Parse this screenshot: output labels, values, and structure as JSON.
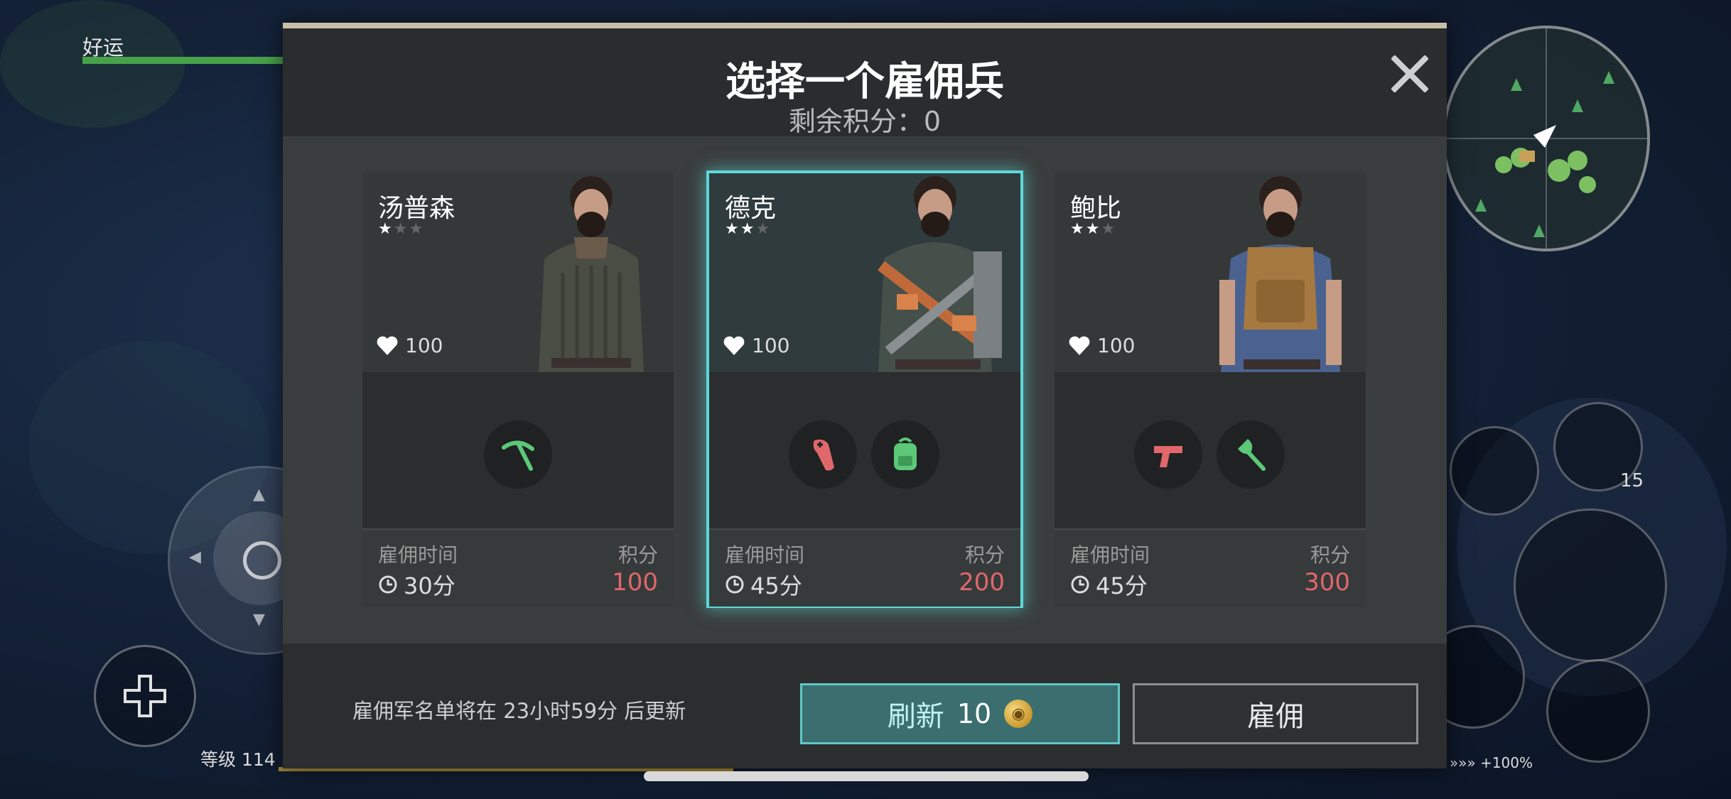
{
  "hud": {
    "player_name": "好运",
    "level_label": "等级 114",
    "item_count": "15",
    "boost_text": "»»» +100%"
  },
  "modal": {
    "title": "选择一个雇佣兵",
    "subtitle": "剩余积分：0",
    "footer_note": "雇佣军名单将在 23小时59分 后更新",
    "refresh_label": "刷新",
    "refresh_cost": "10",
    "hire_label": "雇佣"
  },
  "cards": [
    {
      "name": "汤普森",
      "stars": 1,
      "stars_max": 3,
      "hp": "100",
      "skills": [
        "pickaxe-icon"
      ],
      "time_label": "雇佣时间",
      "time_value": "30分",
      "points_label": "积分",
      "points_value": "100",
      "selected": false
    },
    {
      "name": "德克",
      "stars": 2,
      "stars_max": 3,
      "hp": "100",
      "skills": [
        "medical-arm-icon",
        "backpack-icon"
      ],
      "time_label": "雇佣时间",
      "time_value": "45分",
      "points_label": "积分",
      "points_value": "200",
      "selected": true
    },
    {
      "name": "鲍比",
      "stars": 2,
      "stars_max": 3,
      "hp": "100",
      "skills": [
        "pistol-icon",
        "axe-icon"
      ],
      "time_label": "雇佣时间",
      "time_value": "45分",
      "points_label": "积分",
      "points_value": "300",
      "selected": false
    }
  ],
  "colors": {
    "accent": "#5fd7d8",
    "points": "#e0676b",
    "skill_green": "#5cc878",
    "skill_red": "#e0676b",
    "hp_bar": "#47a24a"
  }
}
